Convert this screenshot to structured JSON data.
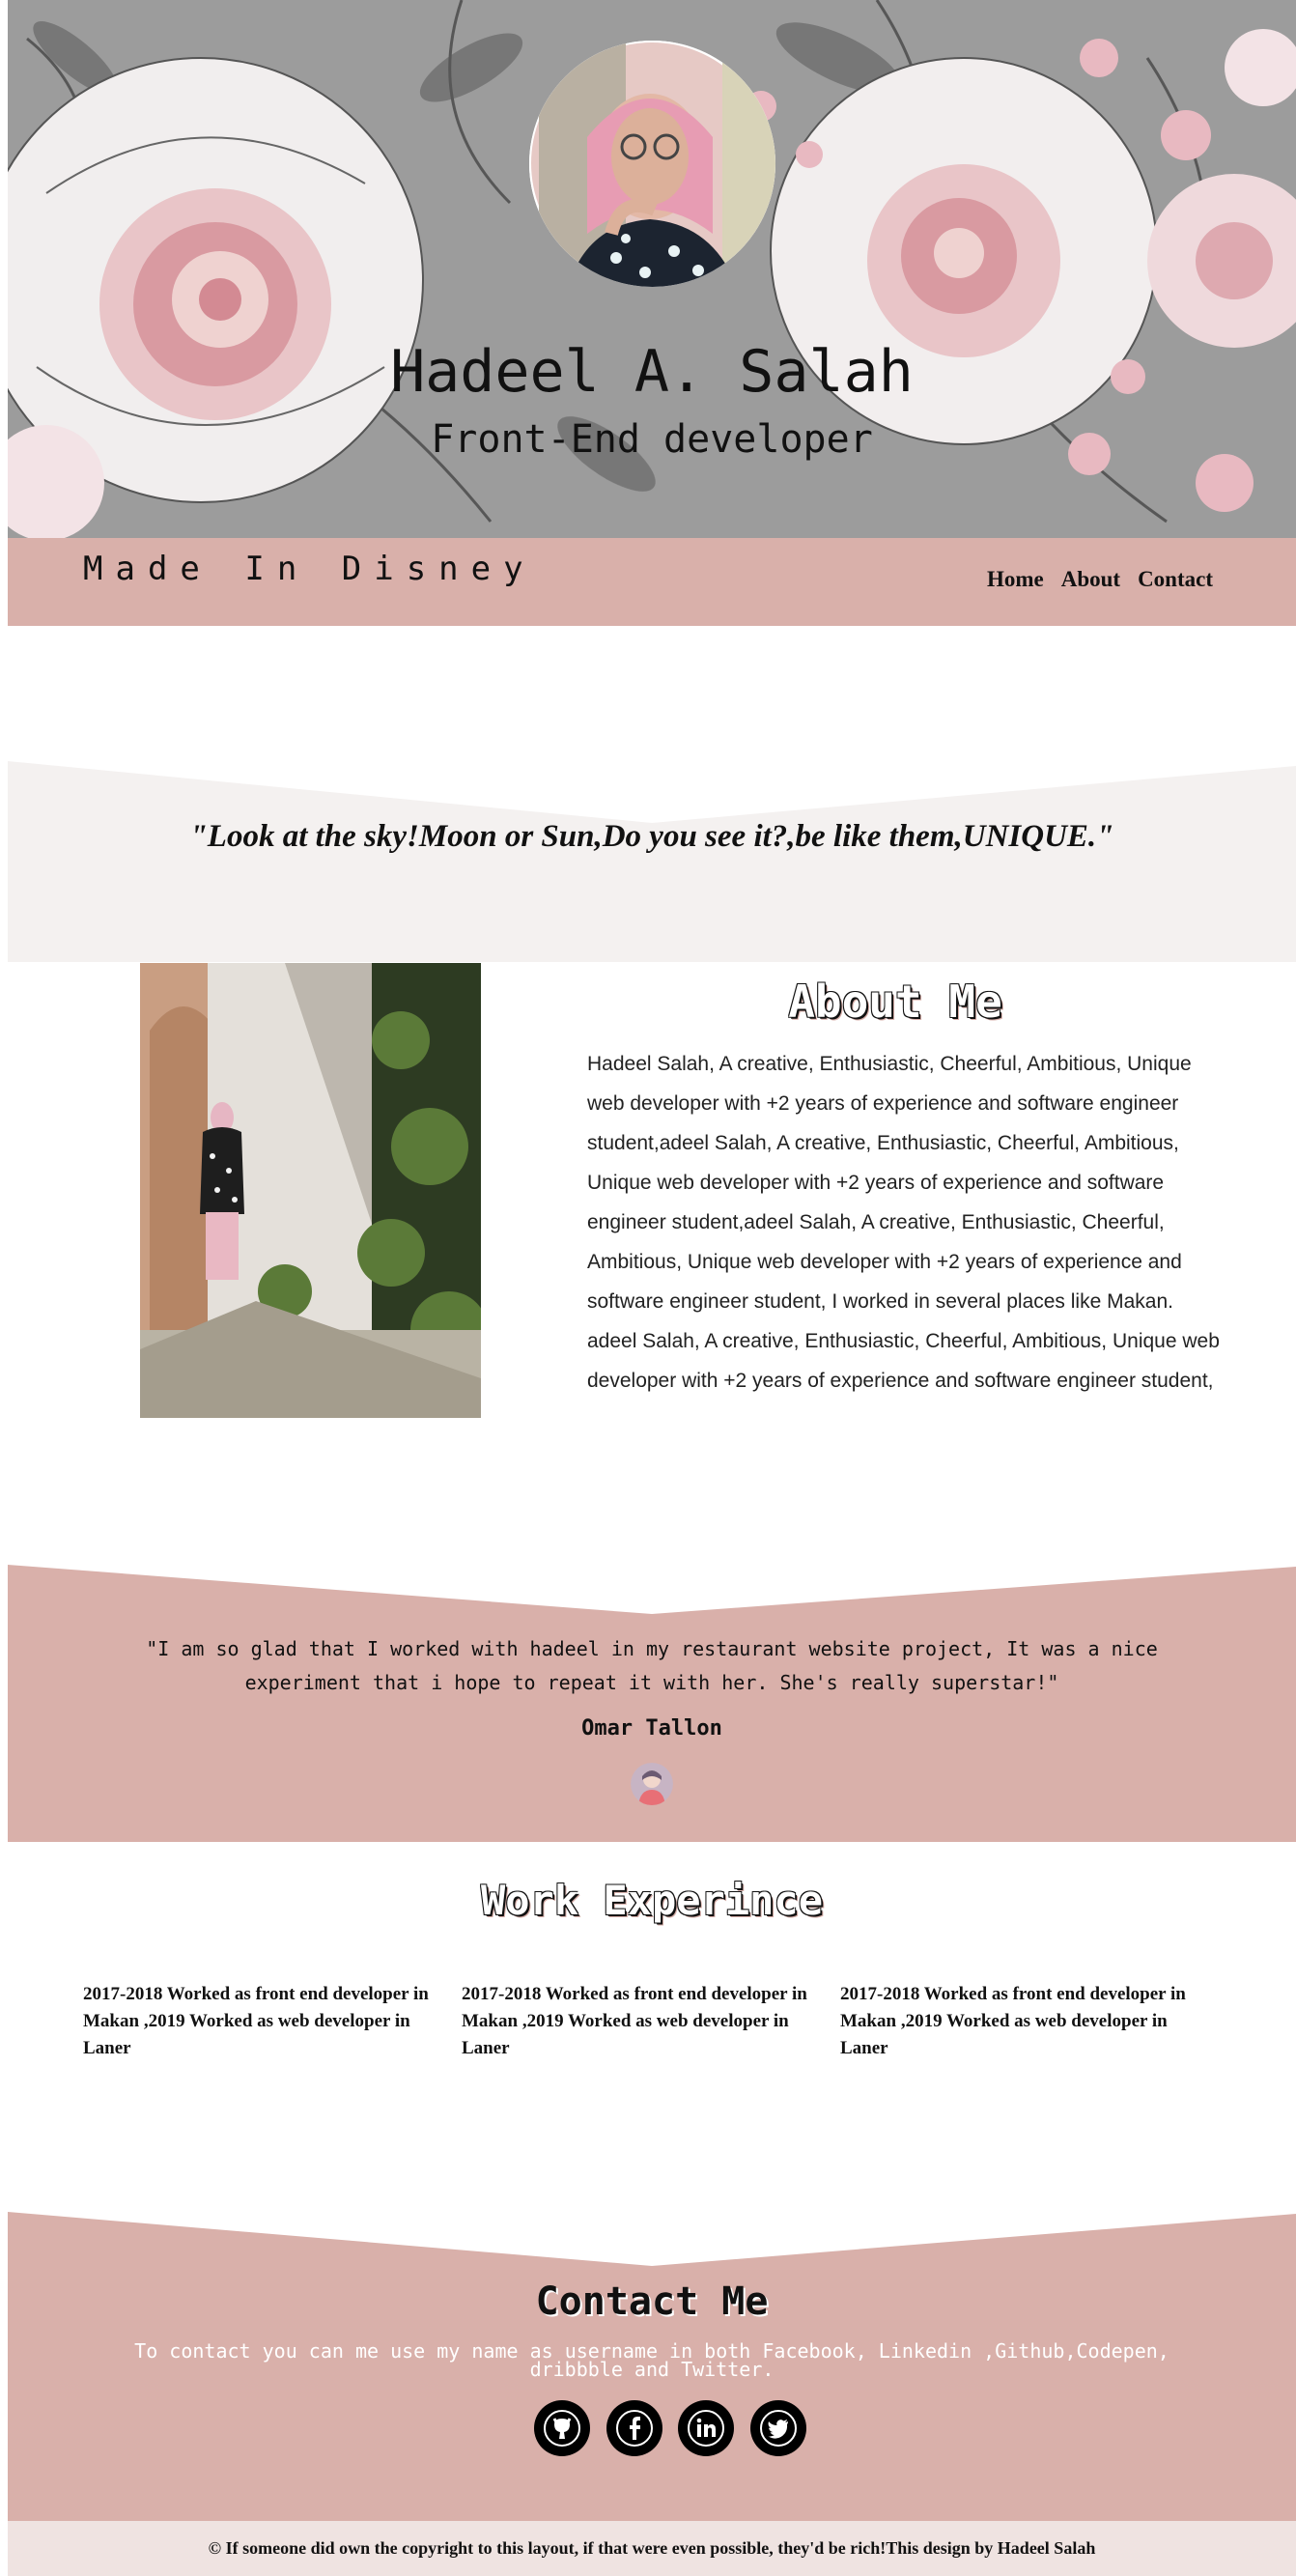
{
  "hero": {
    "name": "Hadeel A. Salah",
    "role": "Front-End developer"
  },
  "nav": {
    "brand": "Made In Disney",
    "items": [
      {
        "label": "Home"
      },
      {
        "label": "About"
      },
      {
        "label": "Contact"
      }
    ]
  },
  "quote": {
    "text": "\"Look at the sky!Moon or Sun,Do you see it?,be like them,UNIQUE.\""
  },
  "about": {
    "title": "About Me",
    "text": "Hadeel Salah, A creative, Enthusiastic, Cheerful, Ambitious, Unique web developer with +2 years of experience and software engineer student,adeel Salah, A creative, Enthusiastic, Cheerful, Ambitious, Unique web developer with +2 years of experience and software engineer student,adeel Salah, A creative, Enthusiastic, Cheerful, Ambitious, Unique web developer with +2 years of experience and software engineer student, I worked in several places like Makan. adeel Salah, A creative, Enthusiastic, Cheerful, Ambitious, Unique web developer with +2 years of experience and software engineer student,"
  },
  "testimonial": {
    "text": "\"I am so glad that I worked with hadeel in my restaurant website project, It was a nice experiment that i hope to repeat it with her. She's really superstar!\"",
    "author": "Omar Tallon"
  },
  "work": {
    "title": "Work Experince",
    "items": [
      {
        "text": "2017-2018 Worked as front end developer in Makan ,2019 Worked as web developer in Laner"
      },
      {
        "text": "2017-2018 Worked as front end developer in Makan ,2019 Worked as web developer in Laner"
      },
      {
        "text": "2017-2018 Worked as front end developer in Makan ,2019 Worked as web developer in Laner"
      }
    ]
  },
  "contact": {
    "title": "Contact Me",
    "text": "To contact you can me use my name as username in both Facebook, Linkedin ,Github,Codepen, dribbble and Twitter.",
    "social": [
      {
        "icon": "github-icon"
      },
      {
        "icon": "facebook-icon"
      },
      {
        "icon": "linkedin-icon"
      },
      {
        "icon": "twitter-icon"
      }
    ]
  },
  "footer": {
    "text": "© If someone did own the copyright to this layout, if that were even possible, they'd be rich!This design by Hadeel Salah"
  },
  "colors": {
    "accent": "#d9b0aa",
    "quote_band": "#f4f1f0",
    "footer_bg": "#efe3e1"
  }
}
